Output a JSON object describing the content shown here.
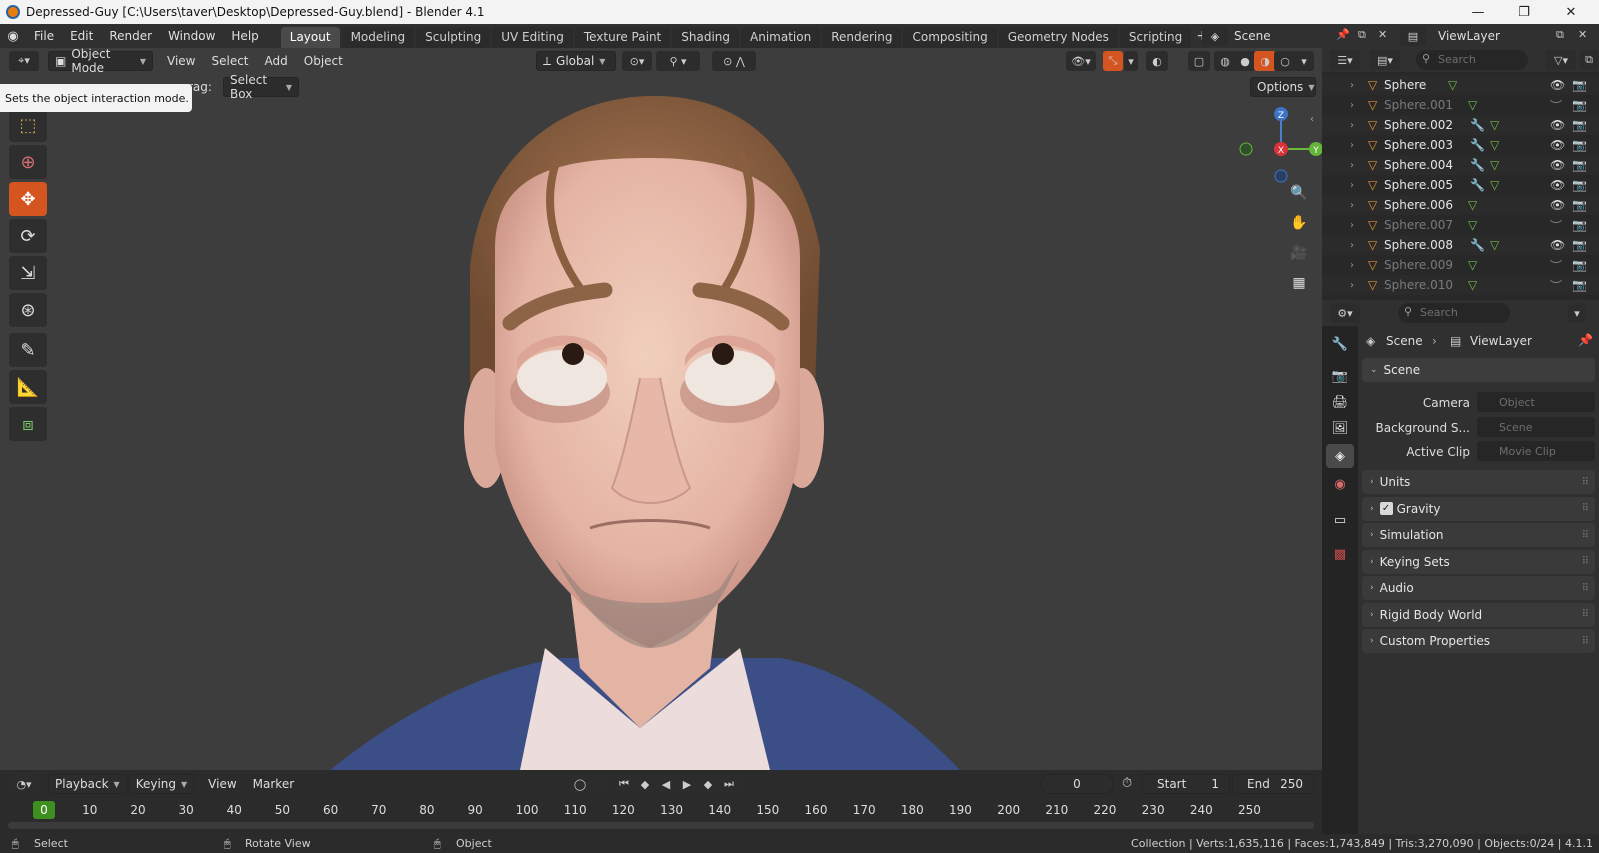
{
  "window": {
    "title": "Depressed-Guy [C:\\Users\\taver\\Desktop\\Depressed-Guy.blend] - Blender 4.1",
    "minimize": "—",
    "maximize": "❐",
    "close": "✕"
  },
  "menu": [
    "File",
    "Edit",
    "Render",
    "Window",
    "Help"
  ],
  "workspaces": [
    "Layout",
    "Modeling",
    "Sculpting",
    "UV Editing",
    "Texture Paint",
    "Shading",
    "Animation",
    "Rendering",
    "Compositing",
    "Geometry Nodes",
    "Scripting"
  ],
  "active_workspace": "Layout",
  "scene_name": "Scene",
  "viewlayer_name": "ViewLayer",
  "viewport": {
    "mode": "Object Mode",
    "menus": [
      "View",
      "Select",
      "Add",
      "Object"
    ],
    "orientation": "Global",
    "drag_label": "rag:",
    "drag_value": "Select Box",
    "options": "Options",
    "tooltip": "Sets the object interaction mode.",
    "gizmo": {
      "x": "X",
      "y": "Y",
      "z": "Z"
    }
  },
  "outliner": {
    "search_placeholder": "Search",
    "items": [
      {
        "name": "Sphere",
        "enabled": true,
        "modifier": false
      },
      {
        "name": "Sphere.001",
        "enabled": false,
        "modifier": false
      },
      {
        "name": "Sphere.002",
        "enabled": true,
        "modifier": true
      },
      {
        "name": "Sphere.003",
        "enabled": true,
        "modifier": true
      },
      {
        "name": "Sphere.004",
        "enabled": true,
        "modifier": true
      },
      {
        "name": "Sphere.005",
        "enabled": true,
        "modifier": true
      },
      {
        "name": "Sphere.006",
        "enabled": true,
        "modifier": false
      },
      {
        "name": "Sphere.007",
        "enabled": false,
        "modifier": false
      },
      {
        "name": "Sphere.008",
        "enabled": true,
        "modifier": true
      },
      {
        "name": "Sphere.009",
        "enabled": false,
        "modifier": false
      },
      {
        "name": "Sphere.010",
        "enabled": false,
        "modifier": false
      }
    ]
  },
  "properties": {
    "search_placeholder": "Search",
    "breadcrumb_scene": "Scene",
    "breadcrumb_viewlayer": "ViewLayer",
    "section_scene": "Scene",
    "camera_label": "Camera",
    "camera_placeholder": "Object",
    "background_label": "Background S...",
    "background_placeholder": "Scene",
    "clip_label": "Active Clip",
    "clip_placeholder": "Movie Clip",
    "panels": [
      "Units",
      "Gravity",
      "Simulation",
      "Keying Sets",
      "Audio",
      "Rigid Body World",
      "Custom Properties"
    ],
    "gravity_checked": true
  },
  "timeline": {
    "playback": "Playback",
    "keying": "Keying",
    "view": "View",
    "marker": "Marker",
    "current_frame": "0",
    "start_label": "Start",
    "start": "1",
    "end_label": "End",
    "end": "250",
    "ticks": [
      "10",
      "20",
      "30",
      "40",
      "50",
      "60",
      "70",
      "80",
      "90",
      "100",
      "110",
      "120",
      "130",
      "140",
      "150",
      "160",
      "170",
      "180",
      "190",
      "200",
      "210",
      "220",
      "230",
      "240",
      "250"
    ],
    "playhead": "0"
  },
  "statusbar": {
    "select": "Select",
    "rotate": "Rotate View",
    "object": "Object",
    "stats": "Collection | Verts:1,635,116 | Faces:1,743,849 | Tris:3,270,090 | Objects:0/24 | 4.1.1"
  }
}
